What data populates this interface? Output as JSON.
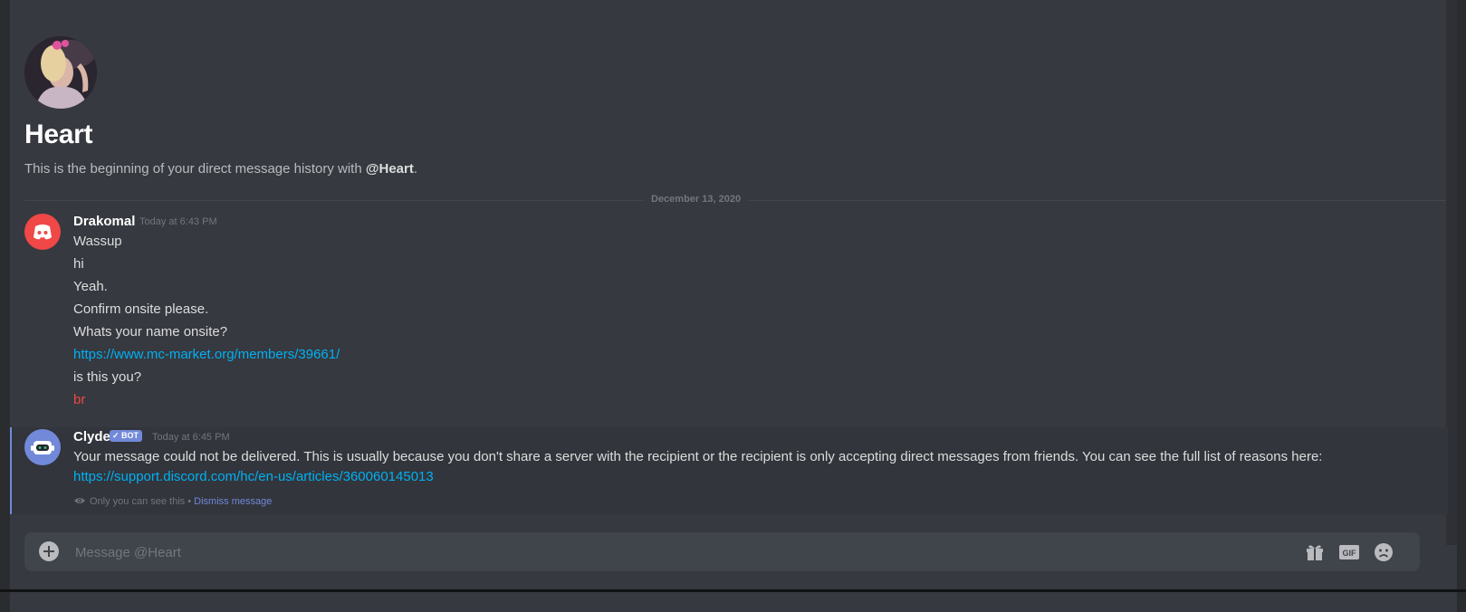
{
  "header": {
    "title": "Heart",
    "intro_prefix": "This is the beginning of your direct message history with ",
    "intro_handle": "@Heart",
    "intro_suffix": "."
  },
  "divider": {
    "date": "December 13, 2020"
  },
  "messages": [
    {
      "author": "Drakomal",
      "timestamp": "Today at 6:43 PM",
      "lines": [
        "Wassup",
        "hi",
        "Yeah.",
        "Confirm onsite please.",
        "Whats your name onsite?",
        "https://www.mc-market.org/members/39661/",
        "is this you?",
        "br"
      ]
    },
    {
      "author": "Clyde",
      "badge": "✓ BOT",
      "timestamp": "Today at 6:45 PM",
      "text": "Your message could not be delivered. This is usually because you don't share a server with the recipient or the recipient is only accepting direct messages from friends. You can see the full list of reasons here:",
      "link": "https://support.discord.com/hc/en-us/articles/360060145013",
      "note": "Only you can see this",
      "note_sep": " • ",
      "dismiss": "Dismiss message"
    }
  ],
  "composer": {
    "placeholder": "Message @Heart",
    "gif_label": "GIF"
  },
  "icons": {
    "attach": "plus-circle-icon",
    "gift": "gift-icon",
    "gif": "gif-icon",
    "emoji": "emoji-icon",
    "eye": "eye-icon"
  },
  "colors": {
    "background": "#36393f",
    "link": "#00b0f4",
    "brand": "#7289da",
    "discord_red": "#f04747"
  }
}
